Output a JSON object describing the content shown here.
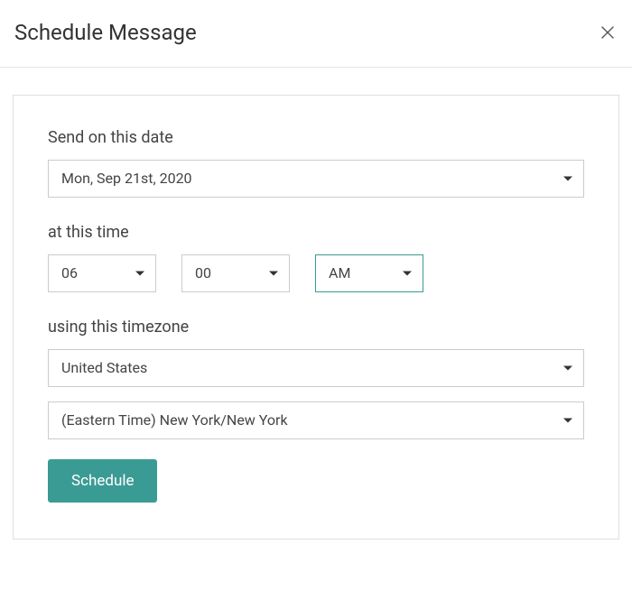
{
  "header": {
    "title": "Schedule Message"
  },
  "form": {
    "date_label": "Send on this date",
    "date_value": "Mon, Sep 21st, 2020",
    "time_label": "at this time",
    "hour_value": "06",
    "minute_value": "00",
    "ampm_value": "AM",
    "timezone_label": "using this timezone",
    "country_value": "United States",
    "timezone_value": "(Eastern Time) New York/New York",
    "submit_label": "Schedule"
  }
}
